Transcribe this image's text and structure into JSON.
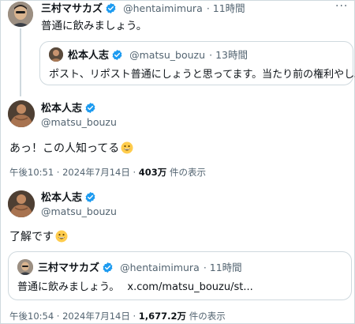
{
  "tweet1": {
    "display_name": "三村マサカズ",
    "handle": "@hentaimimura",
    "time": "11時間",
    "text": "普通に飲みましょう。",
    "more_icon": "more-dots-icon"
  },
  "quoted1": {
    "display_name": "松本人志",
    "handle": "@matsu_bouzu",
    "time": "13時間",
    "text": "ポスト、リポスト普通にしょうと思ってます。当たり前の権利やし。"
  },
  "tweet2": {
    "display_name": "松本人志",
    "handle": "@matsu_bouzu",
    "text": "あっ！この人知ってる",
    "emoji": "grinning-face-emoji",
    "timestamp": "午後10:51 · 2024年7月14日 · ",
    "views_count": "403万",
    "views_label": "件の表示"
  },
  "tweet3": {
    "display_name": "松本人志",
    "handle": "@matsu_bouzu",
    "text": "了解です",
    "emoji": "grinning-face-emoji",
    "timestamp": "午後10:54 · 2024年7月14日 · ",
    "views_count": "1,677.2万",
    "views_label": "件の表示"
  },
  "quoted2": {
    "display_name": "三村マサカズ",
    "handle": "@hentaimimura",
    "time": "11時間",
    "text": "普通に飲みましょう。",
    "link": "x.com/matsu_bouzu/st..."
  },
  "colors": {
    "verified": "#1d9bf0",
    "secondary_text": "#536471",
    "border": "#cfd9de"
  }
}
